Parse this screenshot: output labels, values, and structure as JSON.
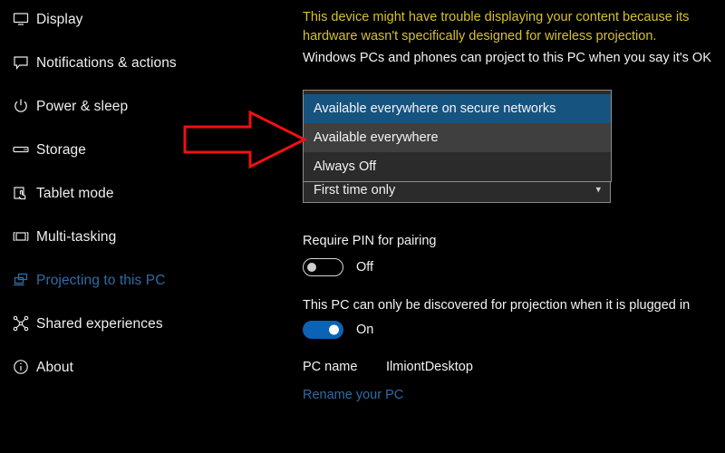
{
  "sidebar": {
    "items": [
      {
        "label": "Display",
        "icon": "monitor-icon",
        "selected": false
      },
      {
        "label": "Notifications & actions",
        "icon": "speech-bubble-icon",
        "selected": false
      },
      {
        "label": "Power & sleep",
        "icon": "power-icon",
        "selected": false
      },
      {
        "label": "Storage",
        "icon": "drive-icon",
        "selected": false
      },
      {
        "label": "Tablet mode",
        "icon": "tablet-hand-icon",
        "selected": false
      },
      {
        "label": "Multi-tasking",
        "icon": "multitask-icon",
        "selected": false
      },
      {
        "label": "Projecting to this PC",
        "icon": "projecting-icon",
        "selected": true
      },
      {
        "label": "Shared experiences",
        "icon": "shared-nodes-icon",
        "selected": false
      },
      {
        "label": "About",
        "icon": "info-icon",
        "selected": false
      }
    ]
  },
  "main": {
    "warning": "This device might have trouble displaying your content because its hardware wasn't specifically designed for wireless projection.",
    "description": "Windows PCs and phones can project to this PC when you say it's OK",
    "availability_dropdown": {
      "options": [
        "Available everywhere on secure networks",
        "Available everywhere",
        "Always Off"
      ],
      "selected_index": 0,
      "hover_index": 1
    },
    "ask_to_project_combo": {
      "value": "First time only",
      "chevron": "chevron-down-icon"
    },
    "require_pin": {
      "label": "Require PIN for pairing",
      "state": "Off",
      "on": false
    },
    "plugged_in_discovery": {
      "label": "This PC can only be discovered for projection when it is plugged in",
      "state": "On",
      "on": true
    },
    "pc_name": {
      "key": "PC name",
      "value": "IlmiontDesktop"
    },
    "rename_link": "Rename your PC"
  },
  "annotation": {
    "arrow": "red-right-arrow",
    "color": "#ee1111"
  },
  "colors": {
    "background": "#000000",
    "accent_blue": "#0a63b4",
    "selection_blue": "#17537f",
    "link_blue": "#2f6ca5",
    "warning_yellow": "#d6c02e",
    "hover_gray": "#3f3f3f",
    "panel_gray": "#2b2b2b"
  }
}
